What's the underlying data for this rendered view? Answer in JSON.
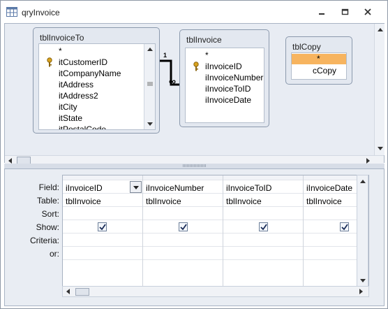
{
  "window": {
    "title": "qryInvoice",
    "controls": [
      "minimize",
      "restore",
      "close"
    ]
  },
  "tables": [
    {
      "name": "tblInvoiceTo",
      "fields": [
        "*",
        "itCustomerID",
        "itCompanyName",
        "itAddress",
        "itAddress2",
        "itCity",
        "itState",
        "itPostalCode"
      ],
      "key_field": "itCustomerID"
    },
    {
      "name": "tblInvoice",
      "fields": [
        "*",
        "iInvoiceID",
        "iInvoiceNumber",
        "iInvoiceToID",
        "iInvoiceDate"
      ],
      "key_field": "iInvoiceID"
    },
    {
      "name": "tblCopy",
      "fields": [
        "*",
        "cCopy"
      ],
      "selected_field": "*"
    }
  ],
  "relationship": {
    "one_label": "1",
    "many_label": "∞"
  },
  "design_grid": {
    "row_labels": [
      "Field:",
      "Table:",
      "Sort:",
      "Show:",
      "Criteria:",
      "or:"
    ],
    "columns": [
      {
        "field": "iInvoiceID",
        "table": "tblInvoice",
        "show": true
      },
      {
        "field": "iInvoiceNumber",
        "table": "tblInvoice",
        "show": true
      },
      {
        "field": "iInvoiceToID",
        "table": "tblInvoice",
        "show": true
      },
      {
        "field": "iInvoiceDate",
        "table": "tblInvoice",
        "show": true
      }
    ]
  },
  "colors": {
    "selected_field": "#f7b45f",
    "pane_bg": "#e8ecf3",
    "border": "#8b99ad"
  }
}
